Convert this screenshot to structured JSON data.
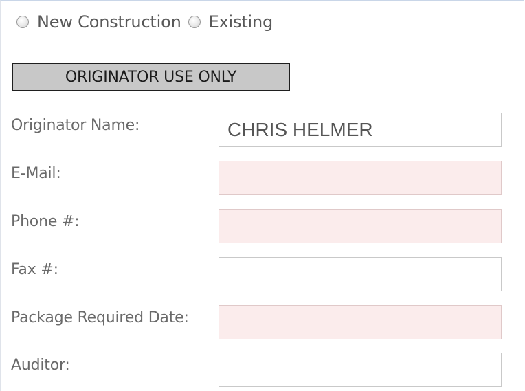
{
  "construction_type": {
    "options": [
      {
        "label": "New Construction",
        "selected": false
      },
      {
        "label": "Existing",
        "selected": false
      }
    ]
  },
  "section": {
    "title": "ORIGINATOR USE ONLY"
  },
  "fields": [
    {
      "label": "Originator Name:",
      "value": "CHRIS HELMER",
      "required": false
    },
    {
      "label": "E-Mail:",
      "value": "",
      "required": true
    },
    {
      "label": "Phone #:",
      "value": "",
      "required": true
    },
    {
      "label": "Fax #:",
      "value": "",
      "required": false
    },
    {
      "label": "Package Required Date:",
      "value": "",
      "required": true
    },
    {
      "label": "Auditor:",
      "value": "",
      "required": false
    }
  ],
  "colors": {
    "required_field_bg": "#fbecec",
    "header_bg": "#c8c8c8"
  }
}
